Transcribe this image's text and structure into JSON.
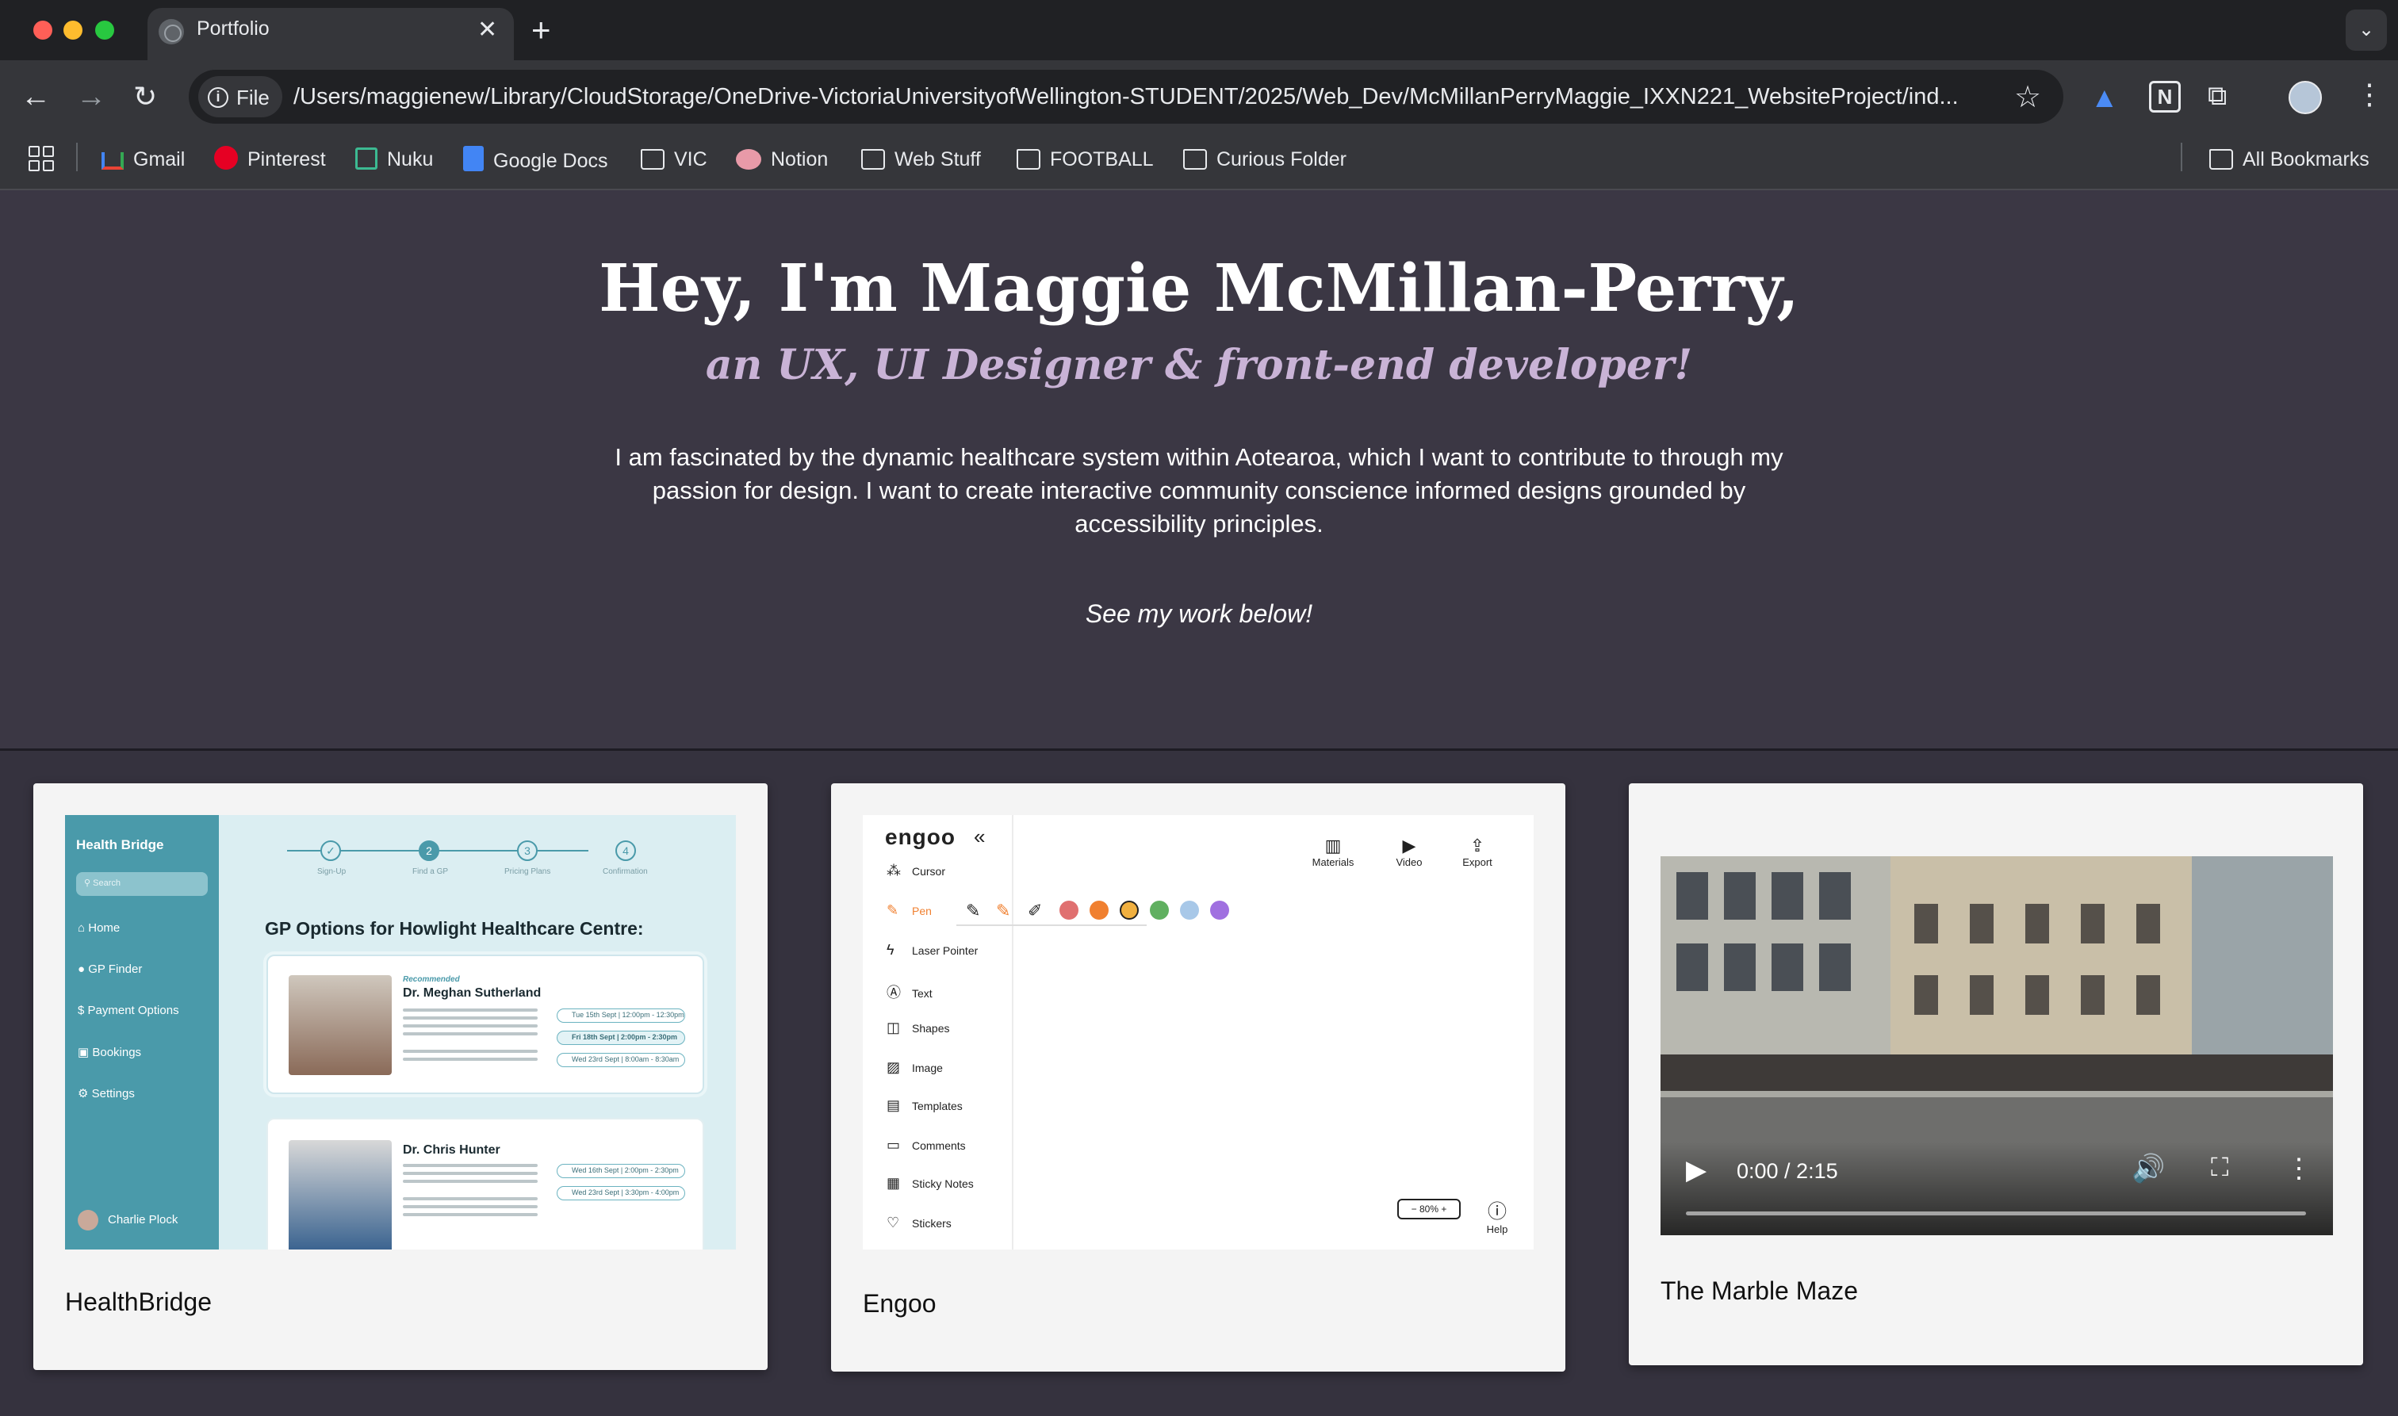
{
  "browser": {
    "tab_title": "Portfolio",
    "address_scheme": "File",
    "url": "/Users/maggienew/Library/CloudStorage/OneDrive-VictoriaUniversityofWellington-STUDENT/2025/Web_Dev/McMillanPerryMaggie_IXXN221_WebsiteProject/ind...",
    "bookmarks": [
      "Gmail",
      "Pinterest",
      "Nuku",
      "Google Docs",
      "VIC",
      "Notion",
      "Web Stuff",
      "FOOTBALL",
      "Curious Folder"
    ],
    "all_bookmarks": "All Bookmarks"
  },
  "hero": {
    "title": "Hey, I'm Maggie McMillan-Perry,",
    "subtitle": "an UX, UI Designer & front-end developer!",
    "description": "I am fascinated by the dynamic healthcare system within Aotearoa, which I want to contribute to through my passion for design. I want to create interactive community conscience informed designs grounded by accessibility principles.",
    "cta": "See my work below!"
  },
  "projects": [
    {
      "title": "HealthBridge",
      "mock": {
        "app_name": "Health Bridge",
        "search_placeholder": "Search",
        "nav": [
          "Home",
          "GP Finder",
          "Payment Options",
          "Bookings",
          "Settings"
        ],
        "user": "Charlie Plock",
        "steps": [
          "Sign-Up",
          "Find a GP",
          "Pricing Plans",
          "Confirmation"
        ],
        "heading": "GP Options for Howlight Healthcare Centre:",
        "recommended_label": "Recommended",
        "doctors": [
          {
            "name": "Dr. Meghan Sutherland",
            "slots": [
              "Tue 15th Sept | 12:00pm - 12:30pm",
              "Fri 18th Sept | 2:00pm - 2:30pm",
              "Wed 23rd Sept | 8:00am - 8:30am"
            ]
          },
          {
            "name": "Dr. Chris Hunter",
            "slots": [
              "Wed 16th Sept | 2:00pm - 2:30pm",
              "Wed 23rd Sept | 3:30pm - 4:00pm"
            ]
          }
        ]
      }
    },
    {
      "title": "Engoo",
      "mock": {
        "logo": "engoo",
        "tools": [
          "Cursor",
          "Pen",
          "Laser Pointer",
          "Text",
          "Shapes",
          "Image",
          "Templates",
          "Comments",
          "Sticky Notes",
          "Stickers"
        ],
        "top_actions": [
          "Materials",
          "Video",
          "Export"
        ],
        "zoom": "80%",
        "help": "Help",
        "pen_colors": [
          "#e07070",
          "#f08030",
          "#f0b040",
          "#60b060",
          "#a8c8e8",
          "#a070e0"
        ]
      }
    },
    {
      "title": "The Marble Maze",
      "video": {
        "time": "0:00 / 2:15",
        "progress": 0
      }
    }
  ]
}
